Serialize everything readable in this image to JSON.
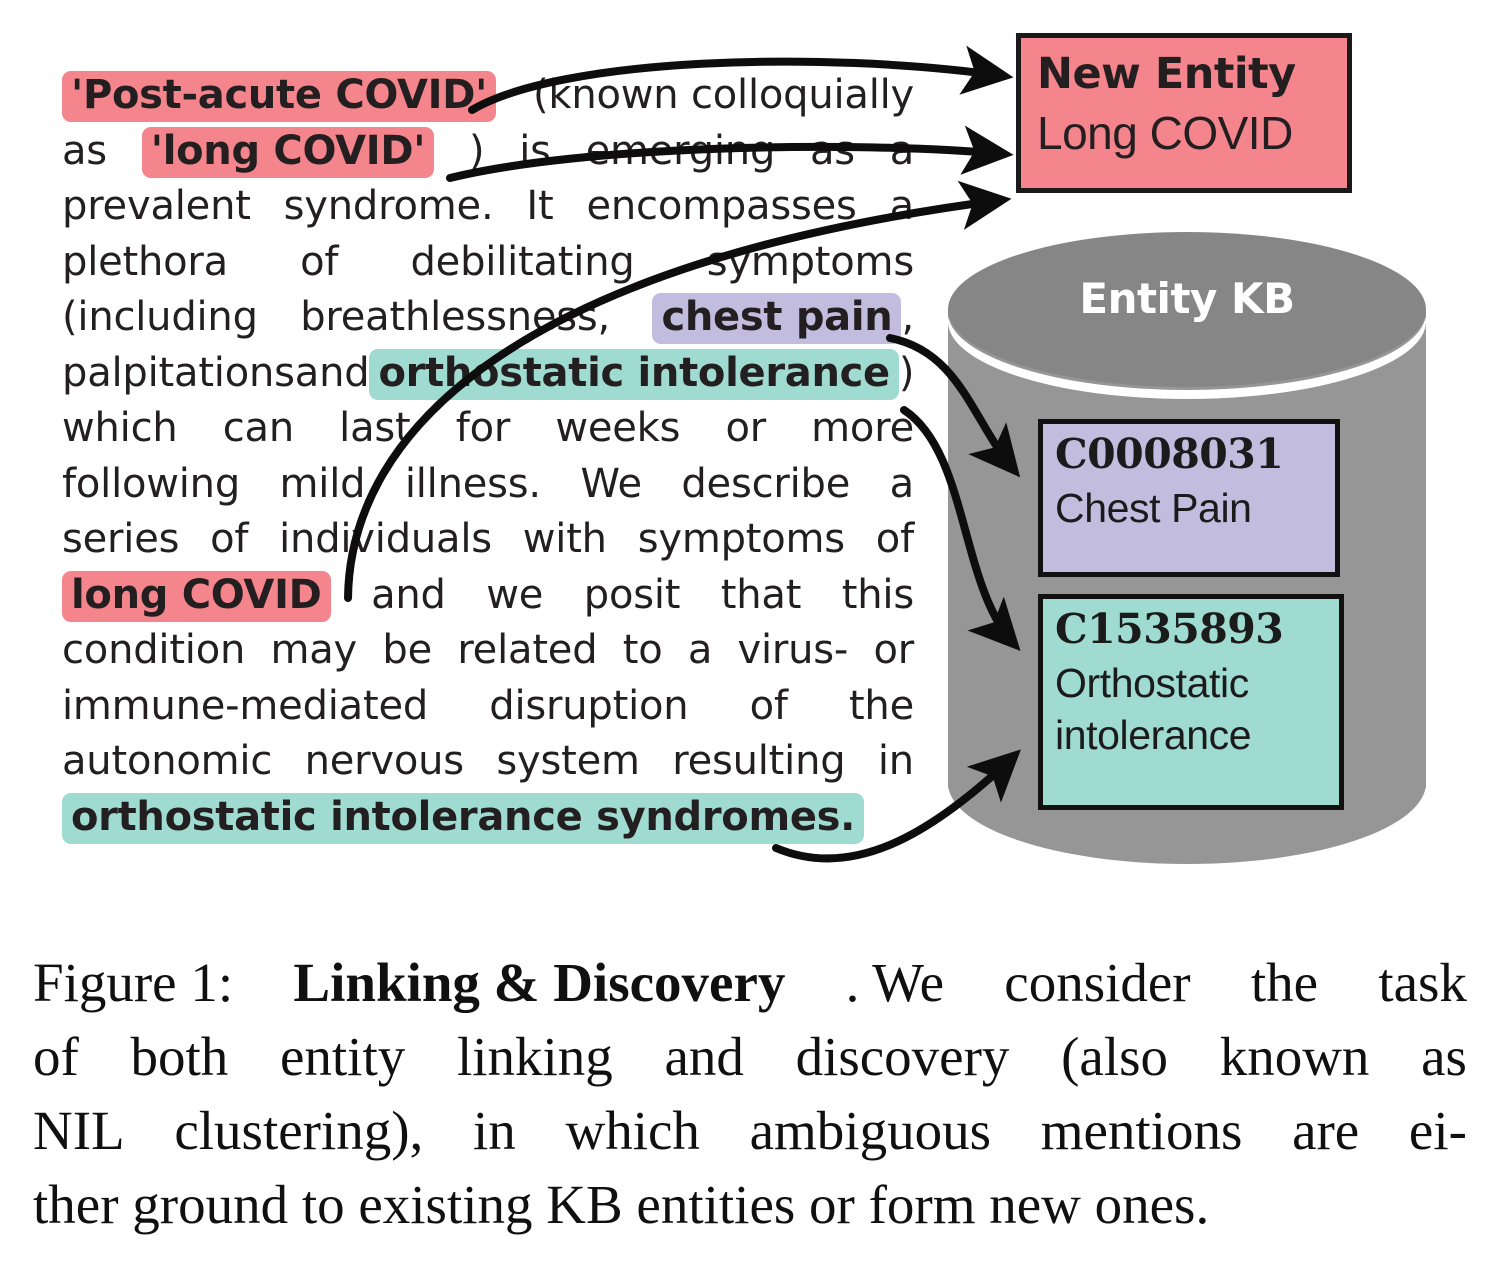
{
  "colors": {
    "new_entity_red": "#f5858c",
    "chest_pain_purple": "#c2bddf",
    "orthostatic_teal": "#9fdbd1",
    "kb_gray": "#969696",
    "kb_top_gray": "#868686",
    "text_black": "#231f20"
  },
  "passage": {
    "line1": {
      "mention": "'Post-acute COVID'",
      "rest": "(known colloquially"
    },
    "line2": {
      "pre": "as",
      "mention": "'long COVID'",
      "a": ")",
      "b": "is",
      "c": "emerging",
      "d": "as",
      "e": "a"
    },
    "line3": [
      "prevalent",
      "syndrome.",
      "It",
      "encompasses",
      "a"
    ],
    "line4": [
      "plethora",
      "of",
      "debilitating",
      "symptoms"
    ],
    "line5": {
      "pre": "(including",
      "mid": "breathlessness,",
      "mention": "chest pain",
      "post": ","
    },
    "line6": {
      "pre": "palpitations",
      "and": "and",
      "mention": "orthostatic intolerance",
      "post": ")"
    },
    "line7": [
      "which",
      "can",
      "last",
      "for",
      "weeks",
      "or",
      "more"
    ],
    "line8": [
      "following",
      "mild",
      "illness.",
      "We",
      "describe",
      "a"
    ],
    "line9": [
      "series",
      "of",
      "individuals",
      "with",
      "symptoms",
      "of"
    ],
    "line10": {
      "mention": "long COVID",
      "a": "and",
      "b": "we",
      "c": "posit",
      "d": "that",
      "e": "this"
    },
    "line11": [
      "condition",
      "may",
      "be",
      "related",
      "to",
      "a",
      "virus-",
      "or"
    ],
    "line12": [
      "immune-mediated",
      "disruption",
      "of",
      "the"
    ],
    "line13": [
      "autonomic",
      "nervous",
      "system",
      "resulting",
      "in"
    ],
    "line14": {
      "mention": "orthostatic intolerance syndromes."
    }
  },
  "new_entity": {
    "title": "New Entity",
    "name": "Long COVID"
  },
  "kb": {
    "title": "Entity KB",
    "entries": [
      {
        "cui": "C0008031",
        "name": "Chest Pain"
      },
      {
        "cui": "C1535893",
        "name_line1": "Orthostatic",
        "name_line2": "intolerance"
      }
    ]
  },
  "caption": {
    "line1": {
      "prefix": "Figure 1:",
      "bold": "Linking & Discovery",
      "rest_words": [
        ". We",
        "consider",
        "the",
        "task"
      ]
    },
    "line2": [
      "of",
      "both",
      "entity",
      "linking",
      "and",
      "discovery",
      "(also",
      "known",
      "as"
    ],
    "line3": [
      "NIL",
      "clustering),",
      "in",
      "which",
      "ambiguous",
      "mentions",
      "are",
      "ei-"
    ],
    "line4": "ther ground to existing KB entities or form new ones."
  }
}
